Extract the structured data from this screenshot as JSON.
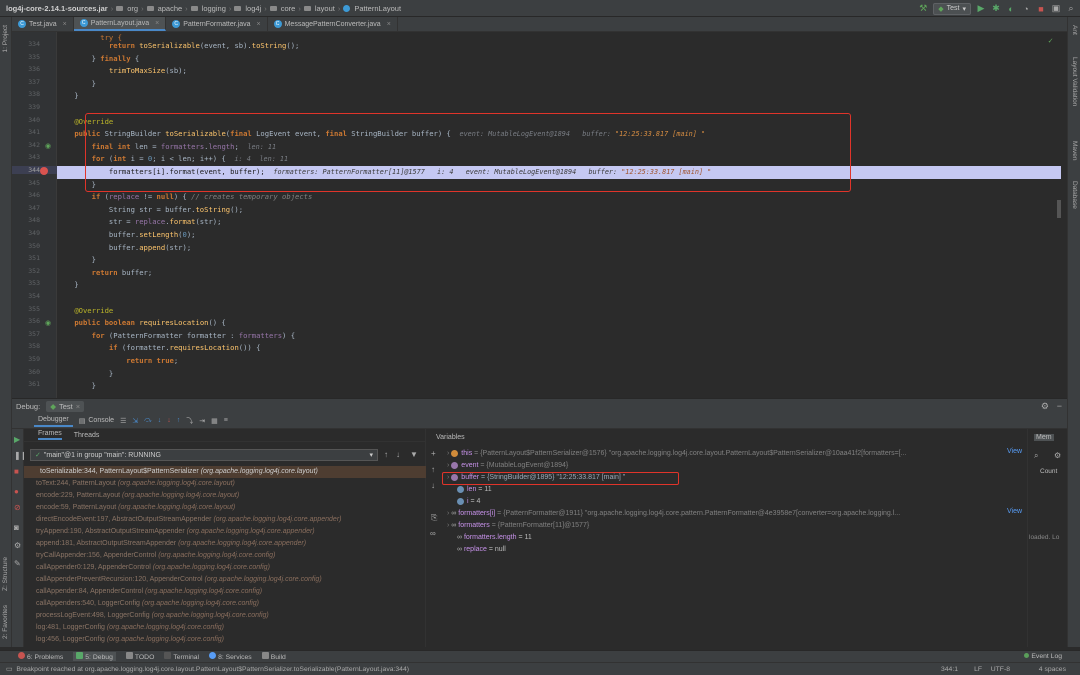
{
  "breadcrumb": {
    "jar": "log4j-core-2.14.1-sources.jar",
    "parts": [
      "org",
      "apache",
      "logging",
      "log4j",
      "core",
      "layout",
      "PatternLayout"
    ]
  },
  "run_config": "Test",
  "tabs": [
    {
      "label": "Test.java",
      "active": false
    },
    {
      "label": "PatternLayout.java",
      "active": true
    },
    {
      "label": "PatternFormatter.java",
      "active": false
    },
    {
      "label": "MessagePatternConverter.java",
      "active": false
    }
  ],
  "line_numbers": [
    "334",
    "335",
    "336",
    "337",
    "338",
    "339",
    "340",
    "341",
    "342",
    "343",
    "344",
    "345",
    "346",
    "347",
    "348",
    "349",
    "350",
    "351",
    "352",
    "353",
    "354",
    "355",
    "356",
    "357",
    "358",
    "359",
    "360",
    "361"
  ],
  "code": {
    "l341_inline": "event: MutableLogEvent@1894   buffer: ",
    "l341_str": "\"12:25:33.817 [main] \"",
    "l342_inline": "len: 11",
    "l343_inline_i": "i: 4",
    "l343_inline_len": "len: 11",
    "l344_inline": "formatters: PatternFormatter[11]@1577   i: 4   event: MutableLogEvent@1894   buffer: ",
    "l344_str": "\"12:25:33.817 [main] \""
  },
  "left_strip": {
    "project": "1: Project",
    "structure": "Z: Structure",
    "favorites": "2: Favorites"
  },
  "right_strip": {
    "ant": "Ant",
    "layout": "Layout Validation",
    "maven": "Maven",
    "db": "Database"
  },
  "debug": {
    "title": "Debug:",
    "session": "Test",
    "debugger_tab": "Debugger",
    "console_tab": "Console",
    "frames_tab": "Frames",
    "threads_tab": "Threads",
    "thread": "\"main\"@1 in group \"main\": RUNNING",
    "variables_label": "Variables",
    "memory_label": "Mem",
    "count_label": "Count",
    "loaded_label": "loaded. Lo"
  },
  "frames": [
    {
      "method": "toSerializable:344, PatternLayout$PatternSerializer",
      "pkg": "(org.apache.logging.log4j.core.layout)",
      "selected": true
    },
    {
      "method": "toText:244, PatternLayout",
      "pkg": "(org.apache.logging.log4j.core.layout)",
      "selected": false
    },
    {
      "method": "encode:229, PatternLayout",
      "pkg": "(org.apache.logging.log4j.core.layout)",
      "selected": false
    },
    {
      "method": "encode:59, PatternLayout",
      "pkg": "(org.apache.logging.log4j.core.layout)",
      "selected": false
    },
    {
      "method": "directEncodeEvent:197, AbstractOutputStreamAppender",
      "pkg": "(org.apache.logging.log4j.core.appender)",
      "selected": false
    },
    {
      "method": "tryAppend:190, AbstractOutputStreamAppender",
      "pkg": "(org.apache.logging.log4j.core.appender)",
      "selected": false
    },
    {
      "method": "append:181, AbstractOutputStreamAppender",
      "pkg": "(org.apache.logging.log4j.core.appender)",
      "selected": false
    },
    {
      "method": "tryCallAppender:156, AppenderControl",
      "pkg": "(org.apache.logging.log4j.core.config)",
      "selected": false
    },
    {
      "method": "callAppender0:129, AppenderControl",
      "pkg": "(org.apache.logging.log4j.core.config)",
      "selected": false
    },
    {
      "method": "callAppenderPreventRecursion:120, AppenderControl",
      "pkg": "(org.apache.logging.log4j.core.config)",
      "selected": false
    },
    {
      "method": "callAppender:84, AppenderControl",
      "pkg": "(org.apache.logging.log4j.core.config)",
      "selected": false
    },
    {
      "method": "callAppenders:540, LoggerConfig",
      "pkg": "(org.apache.logging.log4j.core.config)",
      "selected": false
    },
    {
      "method": "processLogEvent:498, LoggerConfig",
      "pkg": "(org.apache.logging.log4j.core.config)",
      "selected": false
    },
    {
      "method": "log:481, LoggerConfig",
      "pkg": "(org.apache.logging.log4j.core.config)",
      "selected": false
    },
    {
      "method": "log:456, LoggerConfig",
      "pkg": "(org.apache.logging.log4j.core.config)",
      "selected": false
    }
  ],
  "variables": [
    {
      "name": "this",
      "value": "= {PatternLayout$PatternSerializer@1576} \"org.apache.logging.log4j.core.layout.PatternLayout$PatternSerializer@10aa41f2[formatters=[...",
      "view": "View"
    },
    {
      "name": "event",
      "value": "= {MutableLogEvent@1894}",
      "view": ""
    },
    {
      "name": "buffer",
      "value": "= {StringBuilder@1895} \"12:25:33.817 [main] \"",
      "view": ""
    },
    {
      "name": "len",
      "value": "= 11",
      "view": ""
    },
    {
      "name": "i",
      "value": "= 4",
      "view": ""
    },
    {
      "name": "formatters[i]",
      "value": "= {PatternFormatter@1911} \"org.apache.logging.log4j.core.pattern.PatternFormatter@4e3958e7[converter=org.apache.logging.l...",
      "view": "View"
    },
    {
      "name": "formatters",
      "value": "= {PatternFormatter[11]@1577}",
      "view": ""
    },
    {
      "name": "formatters.length",
      "value": "= 11",
      "view": ""
    },
    {
      "name": "replace",
      "value": "= null",
      "view": ""
    }
  ],
  "bottom_tabs": [
    "6: Problems",
    "5: Debug",
    "TODO",
    "Terminal",
    "8: Services",
    "Build"
  ],
  "event_log": "Event Log",
  "status": {
    "message": "Breakpoint reached at org.apache.logging.log4j.core.layout.PatternLayout$PatternSerializer.toSerializable(PatternLayout.java:344)",
    "position": "344:1",
    "lf": "LF",
    "encoding": "UTF-8",
    "indent": "4 spaces"
  }
}
